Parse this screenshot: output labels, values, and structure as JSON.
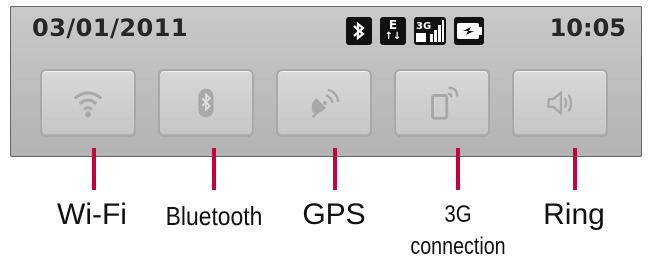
{
  "statusbar": {
    "date": "03/01/2011",
    "time": "10:05",
    "icons": [
      "bluetooth-icon",
      "edge-network-icon",
      "3g-signal-icon",
      "battery-icon"
    ],
    "edge_label": "E",
    "threeg_label": "3G"
  },
  "toggles": [
    {
      "id": "wifi",
      "icon": "wifi-icon"
    },
    {
      "id": "bluetooth",
      "icon": "bluetooth-icon"
    },
    {
      "id": "gps",
      "icon": "gps-icon"
    },
    {
      "id": "3g",
      "icon": "3g-connection-icon"
    },
    {
      "id": "ring",
      "icon": "ring-icon"
    }
  ],
  "callouts": {
    "wifi": "Wi-Fi",
    "bluetooth": "Bluetooth",
    "gps": "GPS",
    "threeg_line1": "3G",
    "threeg_line2": "connection",
    "ring": "Ring"
  },
  "colors": {
    "pointer": "#c6003c",
    "panel": "#c3c3c3",
    "icon_gray": "#a8a8a8"
  }
}
